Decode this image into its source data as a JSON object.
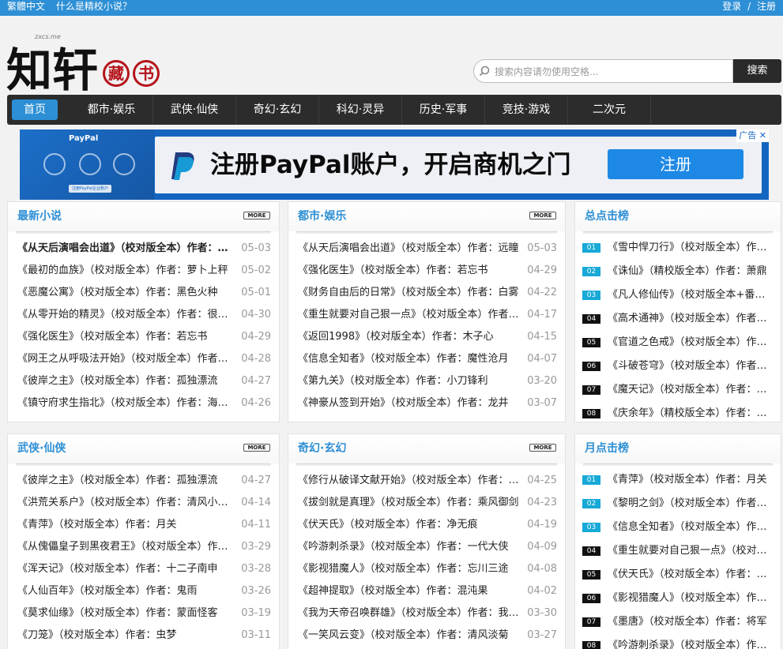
{
  "topbar": {
    "traditional": "繁體中文",
    "about": "什么是精校小说？",
    "login": "登录",
    "sep": "/",
    "register": "注册"
  },
  "logo": {
    "char1": "知",
    "char2": "轩",
    "domain": "zxcs.me",
    "seal1": "藏",
    "seal2": "书"
  },
  "search": {
    "placeholder": "搜索内容请勿使用空格...",
    "button": "搜索"
  },
  "nav": [
    "首页",
    "都市·娱乐",
    "武侠·仙侠",
    "奇幻·玄幻",
    "科幻·灵异",
    "历史·军事",
    "竞技·游戏",
    "二次元"
  ],
  "ad": {
    "brand": "PayPal",
    "mini": "注册PayPal企业账户",
    "headline": "注册PayPal账户，开启商机之门",
    "cta": "注册",
    "tag": "广告"
  },
  "more_label": "MORE",
  "latest": {
    "title": "最新小说",
    "items": [
      {
        "title": "《从天后演唱会出道》（校对版全本）作者：远瞳",
        "date": "05-03"
      },
      {
        "title": "《最初的血族》（校对版全本）作者：萝卜上秤",
        "date": "05-02"
      },
      {
        "title": "《恶魔公寓》（校对版全本）作者：黑色火种",
        "date": "05-01"
      },
      {
        "title": "《从零开始的精灵》（校对版全本）作者：很纯很暧昧",
        "date": "04-30"
      },
      {
        "title": "《强化医生》（校对版全本）作者：若忘书",
        "date": "04-29"
      },
      {
        "title": "《网王之从呼吸法开始》（校对版全本）作者：狂刀",
        "date": "04-28"
      },
      {
        "title": "《彼岸之主》（校对版全本）作者：孤独漂流",
        "date": "04-27"
      },
      {
        "title": "《镇守府求生指北》（校对版全本）作者：海底捞月",
        "date": "04-26"
      }
    ]
  },
  "urban": {
    "title": "都市·娱乐",
    "items": [
      {
        "title": "《从天后演唱会出道》（校对版全本）作者：远瞳",
        "date": "05-03"
      },
      {
        "title": "《强化医生》（校对版全本）作者：若忘书",
        "date": "04-29"
      },
      {
        "title": "《财务自由后的日常》（校对版全本）作者：白雾",
        "date": "04-22"
      },
      {
        "title": "《重生就要对自己狠一点》（校对版全本）作者：言归正传",
        "date": "04-17"
      },
      {
        "title": "《返回1998》（校对版全本）作者：木子心",
        "date": "04-15"
      },
      {
        "title": "《信息全知者》（校对版全本）作者：魔性沧月",
        "date": "04-07"
      },
      {
        "title": "《第九关》（校对版全本）作者：小刀锋利",
        "date": "03-20"
      },
      {
        "title": "《神豪从签到开始》（校对版全本）作者：龙井",
        "date": "03-07"
      }
    ]
  },
  "total_rank": {
    "title": "总点击榜",
    "items": [
      {
        "num": "01",
        "title": "《雪中悍刀行》（校对版全本）作者：烽火戏诸侯"
      },
      {
        "num": "02",
        "title": "《诛仙》（精校版全本）作者：萧鼎"
      },
      {
        "num": "03",
        "title": "《凡人修仙传》（校对版全本+番外）作者：忘语"
      },
      {
        "num": "04",
        "title": "《高术通神》（校对版全本）作者：手握寸关尺"
      },
      {
        "num": "05",
        "title": "《官道之色戒》（校对版全本）作者：无语"
      },
      {
        "num": "06",
        "title": "《斗破苍穹》（校对版全本）作者：天蚕土豆"
      },
      {
        "num": "07",
        "title": "《魔天记》（校对版全本）作者：忘语"
      },
      {
        "num": "08",
        "title": "《庆余年》（精校版全本）作者：猫腻"
      }
    ]
  },
  "wuxia": {
    "title": "武侠·仙侠",
    "items": [
      {
        "title": "《彼岸之主》（校对版全本）作者：孤独漂流",
        "date": "04-27"
      },
      {
        "title": "《洪荒关系户》（校对版全本）作者：清风小阁楼",
        "date": "04-14"
      },
      {
        "title": "《青萍》（校对版全本）作者：月关",
        "date": "04-11"
      },
      {
        "title": "《从傀儡皇子到黑夜君王》（校对版全本）作者：小心",
        "date": "03-29"
      },
      {
        "title": "《浑天记》（校对版全本）作者：十二子南申",
        "date": "03-28"
      },
      {
        "title": "《人仙百年》（校对版全本）作者：鬼雨",
        "date": "03-26"
      },
      {
        "title": "《莫求仙缘》（校对版全本）作者：蒙面怪客",
        "date": "03-19"
      },
      {
        "title": "《刀笼》（校对版全本）作者：虫梦",
        "date": "03-11"
      }
    ]
  },
  "fantasy": {
    "title": "奇幻·玄幻",
    "items": [
      {
        "title": "《修行从破译文献开始》（校对版全本）作者：古羲",
        "date": "04-25"
      },
      {
        "title": "《拔剑就是真理》（校对版全本）作者：乘风御剑",
        "date": "04-23"
      },
      {
        "title": "《伏天氏》（校对版全本）作者：净无痕",
        "date": "04-19"
      },
      {
        "title": "《吟游刺杀录》（校对版全本）作者：一代大侠",
        "date": "04-09"
      },
      {
        "title": "《影视猎魔人》（校对版全本）作者：忘川三途",
        "date": "04-08"
      },
      {
        "title": "《超神提取》（校对版全本）作者：混沌果",
        "date": "04-02"
      },
      {
        "title": "《我为天帝召唤群雄》（校对版全本）作者：我是大魔王",
        "date": "03-30"
      },
      {
        "title": "《一笑风云变》（校对版全本）作者：清风淡菊",
        "date": "03-27"
      }
    ]
  },
  "month_rank": {
    "title": "月点击榜",
    "items": [
      {
        "num": "01",
        "title": "《青萍》（校对版全本）作者：月关"
      },
      {
        "num": "02",
        "title": "《黎明之剑》（校对版全本）作者：远瞳"
      },
      {
        "num": "03",
        "title": "《信息全知者》（校对版全本）作者：魔性沧月"
      },
      {
        "num": "04",
        "title": "《重生就要对自己狠一点》（校对版全本）作者：言归正传"
      },
      {
        "num": "05",
        "title": "《伏天氏》（校对版全本）作者：净无痕"
      },
      {
        "num": "06",
        "title": "《影视猎魔人》（校对版全本）作者：忘川三途"
      },
      {
        "num": "07",
        "title": "《墨唐》（校对版全本）作者：将军"
      },
      {
        "num": "08",
        "title": "《吟游刺杀录》（校对版全本）作者：一代大侠"
      }
    ]
  },
  "colors": {
    "accent": "#2d8fd5",
    "nav_bg": "#2c2c2c",
    "rank_top": "#17a9d7",
    "rank_rest": "#111111"
  }
}
